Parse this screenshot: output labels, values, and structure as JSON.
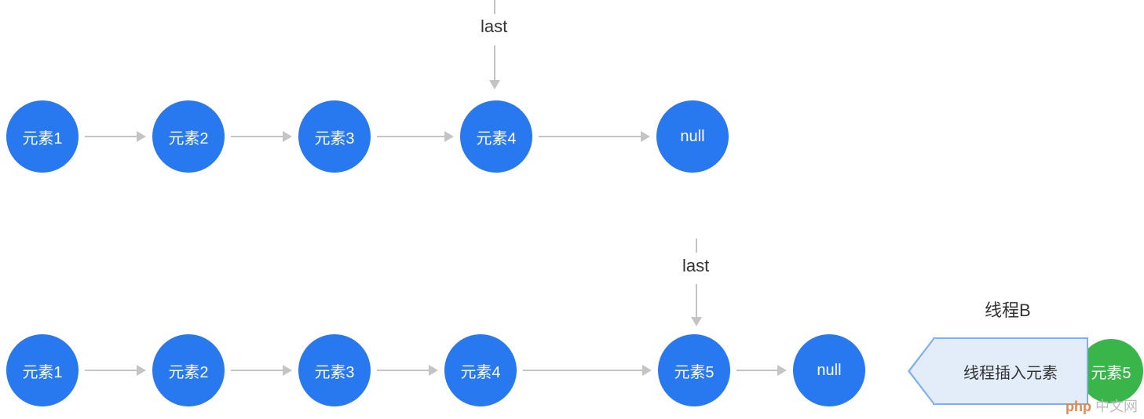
{
  "labels": {
    "last_top": "last",
    "last_bottom": "last",
    "thread_b": "线程B",
    "banner": "线程插入元素"
  },
  "row1": {
    "nodes": [
      "元素1",
      "元素2",
      "元素3",
      "元素4",
      "null"
    ]
  },
  "row2": {
    "nodes": [
      "元素1",
      "元素2",
      "元素3",
      "元素4",
      "元素5",
      "null"
    ]
  },
  "extra_node": "元素5",
  "watermark": {
    "brand": "php",
    "text": "中文网"
  },
  "colors": {
    "blue": "#2878ef",
    "green": "#3ab54a",
    "arrow": "#c4c4c4",
    "banner_bg": "#e3edfa",
    "banner_border": "#7fb0ee"
  }
}
